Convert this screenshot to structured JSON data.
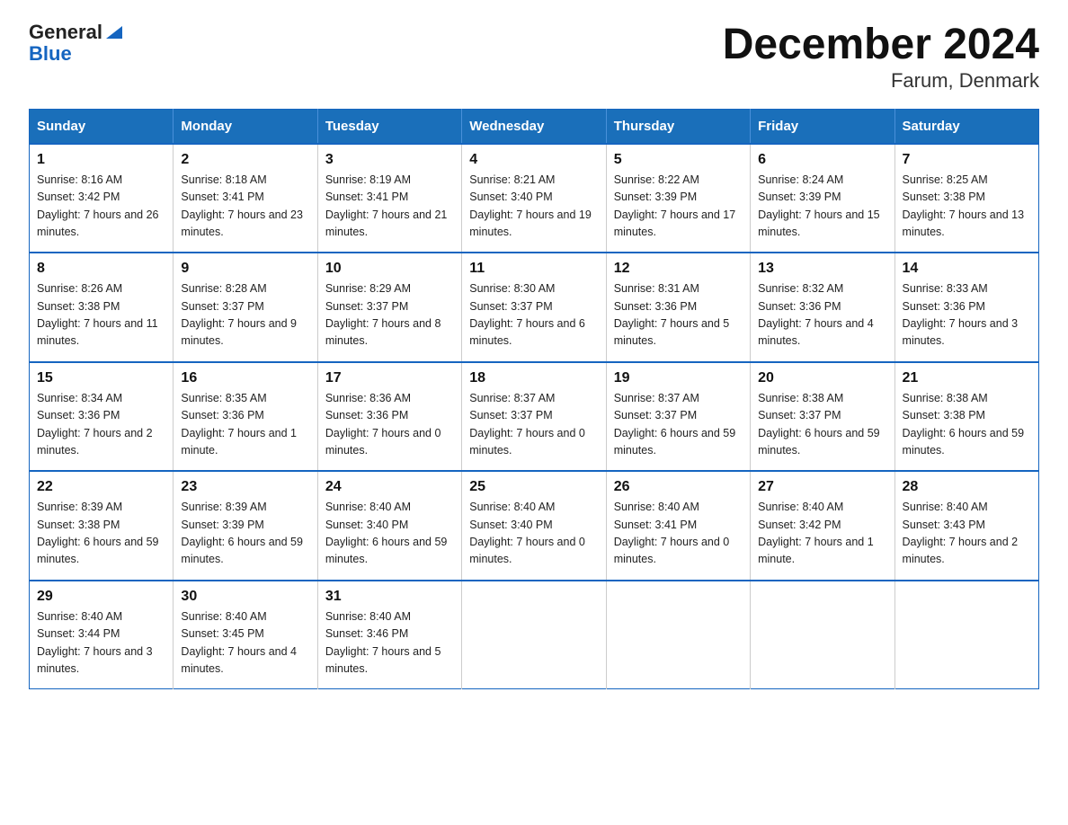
{
  "header": {
    "logo_text1": "General",
    "logo_text2": "Blue",
    "title": "December 2024",
    "subtitle": "Farum, Denmark"
  },
  "weekdays": [
    "Sunday",
    "Monday",
    "Tuesday",
    "Wednesday",
    "Thursday",
    "Friday",
    "Saturday"
  ],
  "weeks": [
    [
      {
        "day": "1",
        "sunrise": "8:16 AM",
        "sunset": "3:42 PM",
        "daylight": "7 hours and 26 minutes."
      },
      {
        "day": "2",
        "sunrise": "8:18 AM",
        "sunset": "3:41 PM",
        "daylight": "7 hours and 23 minutes."
      },
      {
        "day": "3",
        "sunrise": "8:19 AM",
        "sunset": "3:41 PM",
        "daylight": "7 hours and 21 minutes."
      },
      {
        "day": "4",
        "sunrise": "8:21 AM",
        "sunset": "3:40 PM",
        "daylight": "7 hours and 19 minutes."
      },
      {
        "day": "5",
        "sunrise": "8:22 AM",
        "sunset": "3:39 PM",
        "daylight": "7 hours and 17 minutes."
      },
      {
        "day": "6",
        "sunrise": "8:24 AM",
        "sunset": "3:39 PM",
        "daylight": "7 hours and 15 minutes."
      },
      {
        "day": "7",
        "sunrise": "8:25 AM",
        "sunset": "3:38 PM",
        "daylight": "7 hours and 13 minutes."
      }
    ],
    [
      {
        "day": "8",
        "sunrise": "8:26 AM",
        "sunset": "3:38 PM",
        "daylight": "7 hours and 11 minutes."
      },
      {
        "day": "9",
        "sunrise": "8:28 AM",
        "sunset": "3:37 PM",
        "daylight": "7 hours and 9 minutes."
      },
      {
        "day": "10",
        "sunrise": "8:29 AM",
        "sunset": "3:37 PM",
        "daylight": "7 hours and 8 minutes."
      },
      {
        "day": "11",
        "sunrise": "8:30 AM",
        "sunset": "3:37 PM",
        "daylight": "7 hours and 6 minutes."
      },
      {
        "day": "12",
        "sunrise": "8:31 AM",
        "sunset": "3:36 PM",
        "daylight": "7 hours and 5 minutes."
      },
      {
        "day": "13",
        "sunrise": "8:32 AM",
        "sunset": "3:36 PM",
        "daylight": "7 hours and 4 minutes."
      },
      {
        "day": "14",
        "sunrise": "8:33 AM",
        "sunset": "3:36 PM",
        "daylight": "7 hours and 3 minutes."
      }
    ],
    [
      {
        "day": "15",
        "sunrise": "8:34 AM",
        "sunset": "3:36 PM",
        "daylight": "7 hours and 2 minutes."
      },
      {
        "day": "16",
        "sunrise": "8:35 AM",
        "sunset": "3:36 PM",
        "daylight": "7 hours and 1 minute."
      },
      {
        "day": "17",
        "sunrise": "8:36 AM",
        "sunset": "3:36 PM",
        "daylight": "7 hours and 0 minutes."
      },
      {
        "day": "18",
        "sunrise": "8:37 AM",
        "sunset": "3:37 PM",
        "daylight": "7 hours and 0 minutes."
      },
      {
        "day": "19",
        "sunrise": "8:37 AM",
        "sunset": "3:37 PM",
        "daylight": "6 hours and 59 minutes."
      },
      {
        "day": "20",
        "sunrise": "8:38 AM",
        "sunset": "3:37 PM",
        "daylight": "6 hours and 59 minutes."
      },
      {
        "day": "21",
        "sunrise": "8:38 AM",
        "sunset": "3:38 PM",
        "daylight": "6 hours and 59 minutes."
      }
    ],
    [
      {
        "day": "22",
        "sunrise": "8:39 AM",
        "sunset": "3:38 PM",
        "daylight": "6 hours and 59 minutes."
      },
      {
        "day": "23",
        "sunrise": "8:39 AM",
        "sunset": "3:39 PM",
        "daylight": "6 hours and 59 minutes."
      },
      {
        "day": "24",
        "sunrise": "8:40 AM",
        "sunset": "3:40 PM",
        "daylight": "6 hours and 59 minutes."
      },
      {
        "day": "25",
        "sunrise": "8:40 AM",
        "sunset": "3:40 PM",
        "daylight": "7 hours and 0 minutes."
      },
      {
        "day": "26",
        "sunrise": "8:40 AM",
        "sunset": "3:41 PM",
        "daylight": "7 hours and 0 minutes."
      },
      {
        "day": "27",
        "sunrise": "8:40 AM",
        "sunset": "3:42 PM",
        "daylight": "7 hours and 1 minute."
      },
      {
        "day": "28",
        "sunrise": "8:40 AM",
        "sunset": "3:43 PM",
        "daylight": "7 hours and 2 minutes."
      }
    ],
    [
      {
        "day": "29",
        "sunrise": "8:40 AM",
        "sunset": "3:44 PM",
        "daylight": "7 hours and 3 minutes."
      },
      {
        "day": "30",
        "sunrise": "8:40 AM",
        "sunset": "3:45 PM",
        "daylight": "7 hours and 4 minutes."
      },
      {
        "day": "31",
        "sunrise": "8:40 AM",
        "sunset": "3:46 PM",
        "daylight": "7 hours and 5 minutes."
      },
      null,
      null,
      null,
      null
    ]
  ]
}
